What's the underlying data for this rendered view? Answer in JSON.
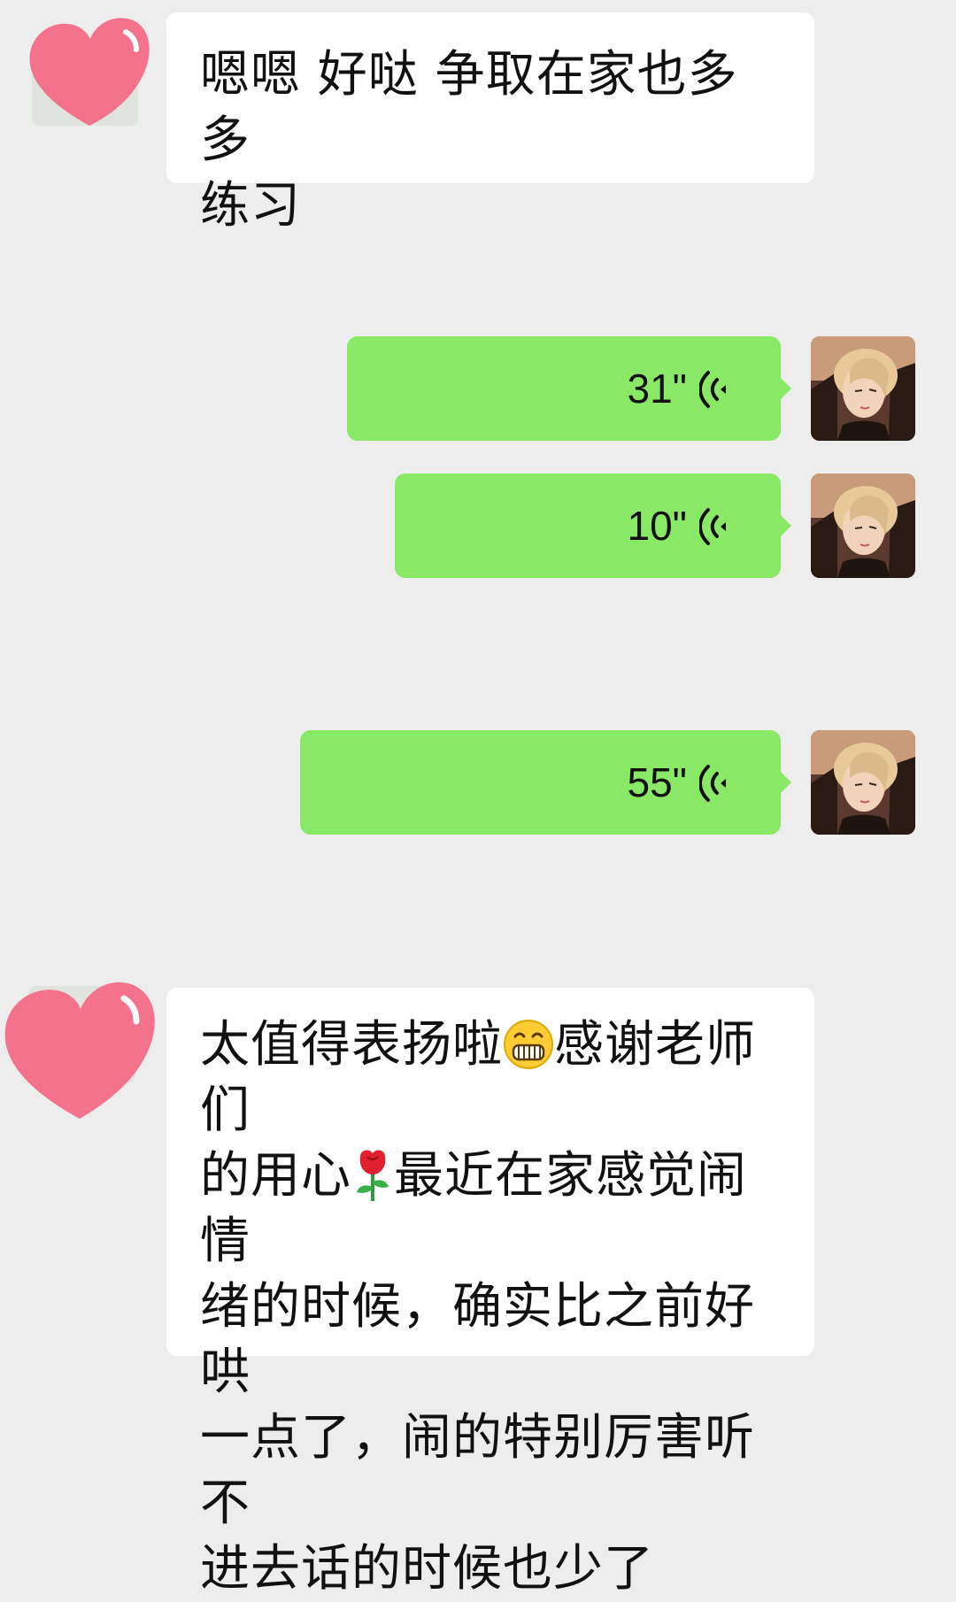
{
  "messages": [
    {
      "sender": "other",
      "text": "嗯嗯 好哒 争取在家也多多\n练习"
    },
    {
      "sender": "self",
      "type": "voice",
      "duration": "31\"",
      "icon": "voice-wave-icon"
    },
    {
      "sender": "self",
      "type": "voice",
      "duration": "10\"",
      "icon": "voice-wave-icon"
    },
    {
      "sender": "self",
      "type": "voice",
      "duration": "55\"",
      "icon": "voice-wave-icon"
    },
    {
      "sender": "other",
      "text_part1": "太值得表扬啦",
      "emoji1": "grin-emoji",
      "text_part2": "感谢老师们\n的用心",
      "emoji2": "rose-emoji",
      "text_part3": "最近在家感觉闹情\n绪的时候，确实比之前好哄\n一点了，闹的特别厉害听不\n进去话的时候也少了"
    }
  ],
  "avatars": {
    "other": "heart-sticker-icon",
    "self": "girl-portrait-avatar"
  },
  "colors": {
    "background": "#ededed",
    "incoming_bubble": "#ffffff",
    "outgoing_bubble": "#89e967",
    "heart": "#f4728c"
  }
}
